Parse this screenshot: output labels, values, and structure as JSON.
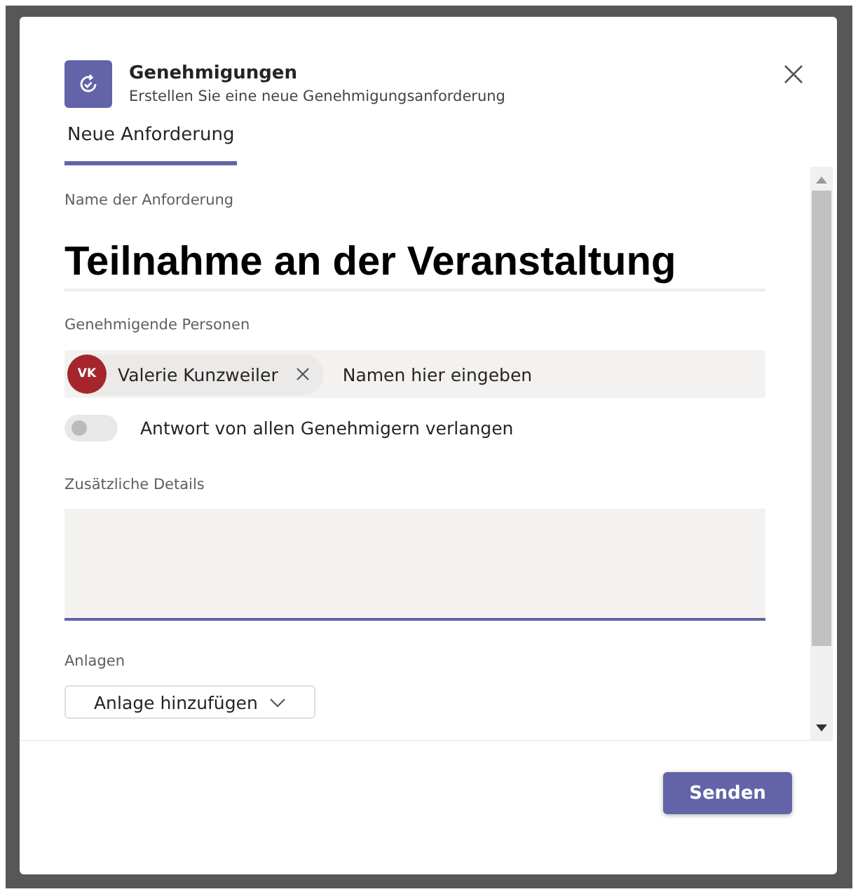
{
  "header": {
    "title": "Genehmigungen",
    "subtitle": "Erstellen Sie eine neue Genehmigungsanforderung"
  },
  "tabs": [
    {
      "label": "Neue Anforderung",
      "selected": true
    }
  ],
  "form": {
    "name_label": "Name der Anforderung",
    "name_value": "Teilnahme an der Veranstaltung",
    "approvers_label": "Genehmigende Personen",
    "approvers": [
      {
        "initials": "VK",
        "name": "Valerie Kunzweiler",
        "color": "#a4262c"
      }
    ],
    "approvers_placeholder": "Namen hier eingeben",
    "toggle": {
      "label": "Antwort von allen Genehmigern verlangen",
      "on": false
    },
    "details_label": "Zusätzliche Details",
    "details_focused": true,
    "attachments_label": "Anlagen",
    "attachment_button": "Anlage hinzufügen"
  },
  "footer": {
    "button": "Senden"
  }
}
